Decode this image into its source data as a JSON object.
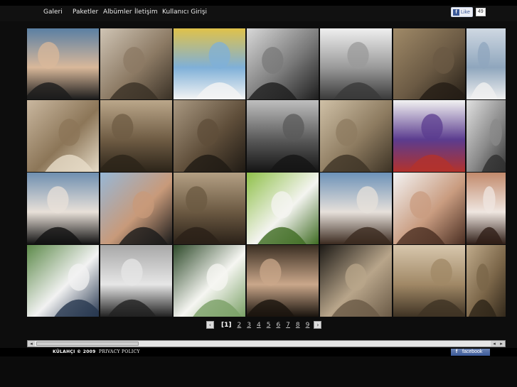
{
  "nav": {
    "items": [
      "Galeri",
      "Paketler",
      "Albümler",
      "İletişim",
      "Kullanıcı Girişi"
    ]
  },
  "facebook_like": {
    "label": "Like",
    "count": "49",
    "icon": "f"
  },
  "gallery": {
    "photos": [
      {
        "tone": "color",
        "c1": "#5a7fa3",
        "c2": "#d9b89a",
        "c3": "#1c1c1c"
      },
      {
        "tone": "sepia",
        "c1": "#cfc4b4",
        "c2": "#8c7a64",
        "c3": "#3a3126"
      },
      {
        "tone": "color",
        "c1": "#e0c24a",
        "c2": "#7fb0d8",
        "c3": "#f4f4f4"
      },
      {
        "tone": "bw",
        "c1": "#d8d8d8",
        "c2": "#7a7a7a",
        "c3": "#1e1e1e"
      },
      {
        "tone": "bw",
        "c1": "#efefef",
        "c2": "#9a9a9a",
        "c3": "#3a3a3a"
      },
      {
        "tone": "sepia",
        "c1": "#a08a68",
        "c2": "#6b5a44",
        "c3": "#241d15"
      },
      {
        "tone": "bluish",
        "c1": "#cfd8e2",
        "c2": "#8fa6bd",
        "c3": "#f0f0f0"
      },
      {
        "tone": "sepia",
        "c1": "#c9b79f",
        "c2": "#8c7658",
        "c3": "#e7dcc8"
      },
      {
        "tone": "sepia",
        "c1": "#bba78a",
        "c2": "#6f5c44",
        "c3": "#2c2419"
      },
      {
        "tone": "sepia",
        "c1": "#a99881",
        "c2": "#5f4e3a",
        "c3": "#1f1a14"
      },
      {
        "tone": "bw",
        "c1": "#bfbfbf",
        "c2": "#5a5a5a",
        "c3": "#151515"
      },
      {
        "tone": "sepia",
        "c1": "#cfc0a6",
        "c2": "#8d7b60",
        "c3": "#3d3325"
      },
      {
        "tone": "color",
        "c1": "#f2f2f2",
        "c2": "#5b3c8f",
        "c3": "#b3322c"
      },
      {
        "tone": "bw",
        "c1": "#e0e0e0",
        "c2": "#8a8a8a",
        "c3": "#2f2f2f"
      },
      {
        "tone": "color",
        "c1": "#6f8fb0",
        "c2": "#e8e0d8",
        "c3": "#121212"
      },
      {
        "tone": "color",
        "c1": "#97b7d6",
        "c2": "#c89a7a",
        "c3": "#1a1a1a"
      },
      {
        "tone": "sepia",
        "c1": "#b4a084",
        "c2": "#6b5942",
        "c3": "#2a2118"
      },
      {
        "tone": "color",
        "c1": "#8fc04a",
        "c2": "#f4f4f0",
        "c3": "#3e6b22"
      },
      {
        "tone": "color",
        "c1": "#6d92b8",
        "c2": "#e6e0da",
        "c3": "#3b2a1f"
      },
      {
        "tone": "color",
        "c1": "#f3f3f3",
        "c2": "#c99c80",
        "c3": "#4a2e22"
      },
      {
        "tone": "color",
        "c1": "#c28a6c",
        "c2": "#efe6e0",
        "c3": "#2f1e17"
      },
      {
        "tone": "color",
        "c1": "#5d8a4a",
        "c2": "#f2f2f2",
        "c3": "#27374f"
      },
      {
        "tone": "bw",
        "c1": "#a8a8a8",
        "c2": "#e6e6e6",
        "c3": "#222222"
      },
      {
        "tone": "color",
        "c1": "#2e4a2a",
        "c2": "#f6f6f2",
        "c3": "#7aa066"
      },
      {
        "tone": "sepia",
        "c1": "#3a2e22",
        "c2": "#caa78a",
        "c3": "#1a140e"
      },
      {
        "tone": "sepia",
        "c1": "#1d1a16",
        "c2": "#b8a58a",
        "c3": "#6a5a46"
      },
      {
        "tone": "sepia",
        "c1": "#d8c7ad",
        "c2": "#a08866",
        "c3": "#3f3324"
      },
      {
        "tone": "sepia",
        "c1": "#c0ab8b",
        "c2": "#7a6548",
        "c3": "#2d2418"
      }
    ]
  },
  "pagination": {
    "prev": "‹",
    "current": "[1]",
    "pages": [
      "2",
      "3",
      "4",
      "5",
      "6",
      "7",
      "8",
      "9"
    ],
    "next": "›"
  },
  "scrollbar": {
    "left_arrow": "◂",
    "right_arrow": "▸"
  },
  "footer": {
    "copyright": "KÜLAHÇI © 2009",
    "privacy": "PRIVACY POLICY",
    "facebook_badge": "facebook",
    "facebook_badge_icon": "f"
  }
}
